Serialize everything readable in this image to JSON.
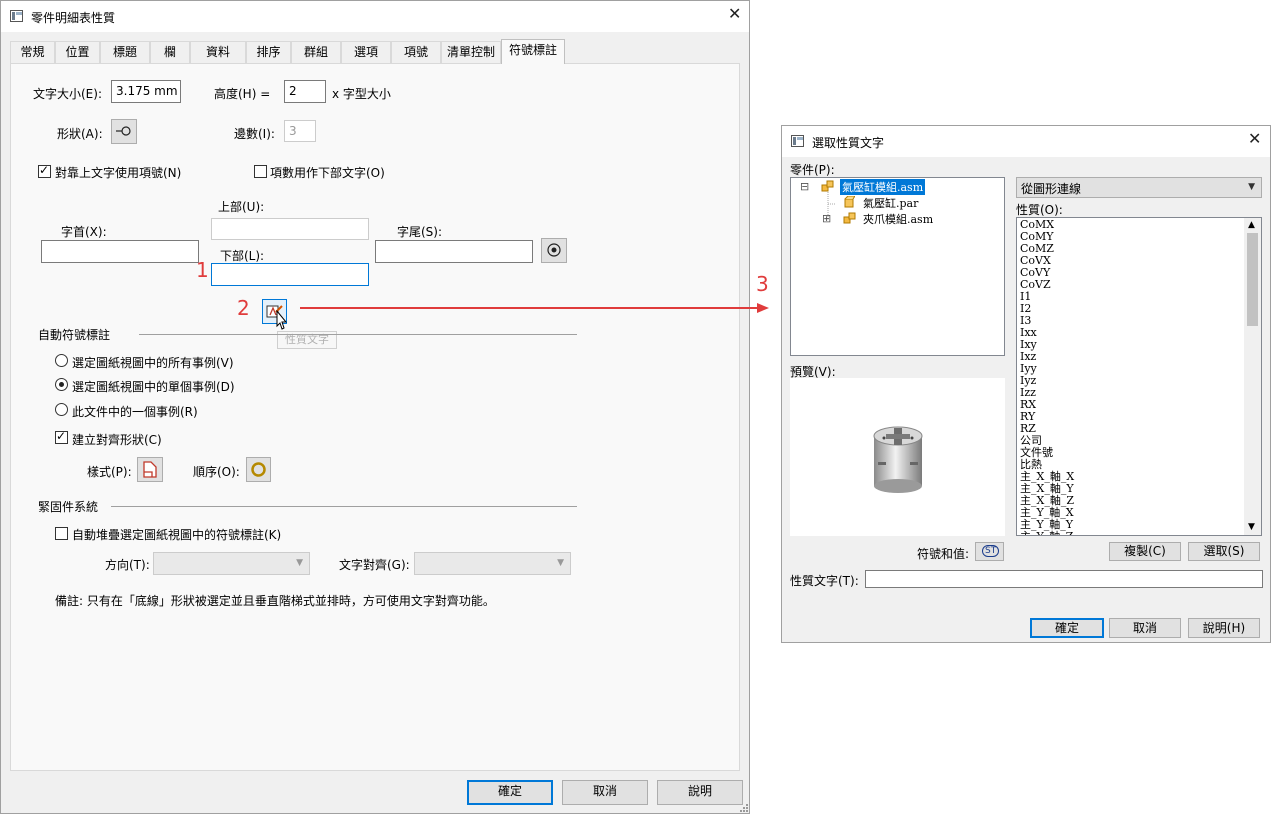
{
  "main_dialog": {
    "title": "零件明細表性質",
    "close_glyph": "✕",
    "tabs": [
      "常規",
      "位置",
      "標題",
      "欄",
      "資料",
      "排序",
      "群組",
      "選項",
      "項號",
      "清單控制",
      "符號標註"
    ],
    "active_tab": "符號標註",
    "text_size_label": "文字大小(E):",
    "text_size_value": "3.175 mm",
    "height_label": "高度(H) =",
    "height_value": "2",
    "height_unit": "x 字型大小",
    "shape_label": "形狀(A):",
    "sides_label": "邊數(I):",
    "sides_value": "3",
    "use_item_number_label": "對靠上文字使用項號(N)",
    "use_item_number_checked": true,
    "item_count_label": "項數用作下部文字(O)",
    "item_count_checked": false,
    "upper_label": "上部(U):",
    "prefix_label": "字首(X):",
    "suffix_label": "字尾(S):",
    "lower_label": "下部(L):",
    "auto_balloon_section": "自動符號標註",
    "radio_all_label": "選定圖紙視圖中的所有事例(V)",
    "radio_single_label": "選定圖紙視圖中的單個事例(D)",
    "radio_one_label": "此文件中的一個事例(R)",
    "selected_radio": "single",
    "create_align_label": "建立對齊形狀(C)",
    "create_align_checked": true,
    "style_label": "樣式(P):",
    "order_label": "順序(O):",
    "fastener_section": "緊固件系統",
    "auto_stack_label": "自動堆疊選定圖紙視圖中的符號標註(K)",
    "auto_stack_checked": false,
    "direction_label": "方向(T):",
    "text_align_label": "文字對齊(G):",
    "note_text": "備註: 只有在「底線」形狀被選定並且垂直階梯式並排時，方可使用文字對齊功能。",
    "tooltip": "性質文字",
    "ok_button": "確定",
    "cancel_button": "取消",
    "help_button": "說明"
  },
  "annotations": {
    "step1": "1",
    "step2": "2",
    "step3": "3",
    "arrow_color": "#e03c3c"
  },
  "select_dialog": {
    "title": "選取性質文字",
    "close_glyph": "✕",
    "parts_label": "零件(P):",
    "tree": [
      {
        "label": "氣壓缸模組.asm",
        "expander": "⊟",
        "selected": true
      },
      {
        "label": "氣壓缸.par"
      },
      {
        "label": "夾爪模組.asm",
        "expander": "⊞"
      }
    ],
    "source_combo": "從圖形連線",
    "properties_label": "性質(O):",
    "properties": [
      "CoMX",
      "CoMY",
      "CoMZ",
      "CoVX",
      "CoVY",
      "CoVZ",
      "I1",
      "I2",
      "I3",
      "Ixx",
      "Ixy",
      "Ixz",
      "Iyy",
      "Iyz",
      "Izz",
      "RX",
      "RY",
      "RZ",
      "公司",
      "文件號",
      "比熱",
      "主_X_軸_X",
      "主_X_軸_Y",
      "主_X_軸_Z",
      "主_Y_軸_X",
      "主_Y_軸_Y",
      "主_Y_軸_Z"
    ],
    "preview_label": "預覽(V):",
    "symbol_label": "符號和值:",
    "symbol_btn": "ST",
    "copy_button": "複製(C)",
    "select_button": "選取(S)",
    "property_text_label": "性質文字(T):",
    "property_text_value": "",
    "ok_button": "確定",
    "cancel_button": "取消",
    "help_button": "說明(H)"
  }
}
